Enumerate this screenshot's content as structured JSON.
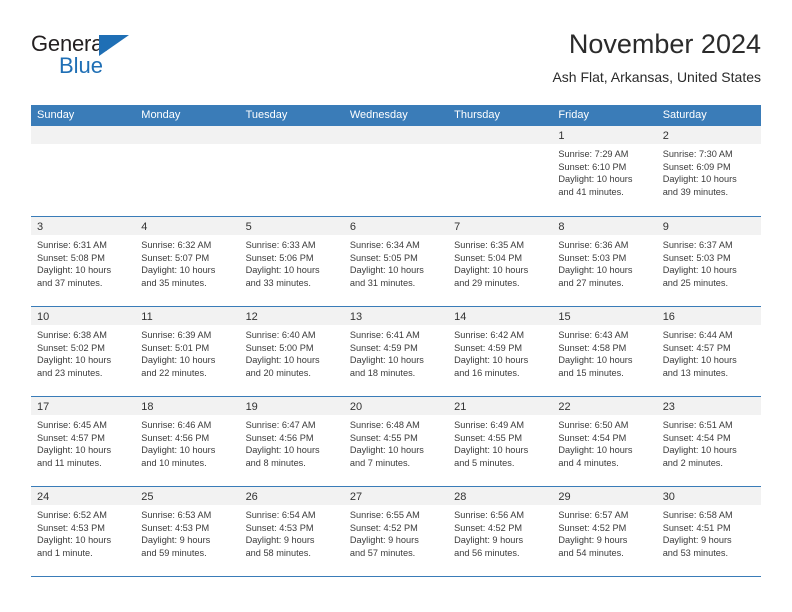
{
  "brand": {
    "name_top": "General",
    "name_bottom": "Blue",
    "triangle_color": "#1f6fb5"
  },
  "header": {
    "title": "November 2024",
    "subtitle": "Ash Flat, Arkansas, United States"
  },
  "theme": {
    "header_blue": "#3a7cb8",
    "daynum_band": "#f2f2f2",
    "text": "#3b3b3b"
  },
  "weekdays": [
    "Sunday",
    "Monday",
    "Tuesday",
    "Wednesday",
    "Thursday",
    "Friday",
    "Saturday"
  ],
  "weeks": [
    [
      {
        "empty": true
      },
      {
        "empty": true
      },
      {
        "empty": true
      },
      {
        "empty": true
      },
      {
        "empty": true
      },
      {
        "day": "1",
        "sunrise": "Sunrise: 7:29 AM",
        "sunset": "Sunset: 6:10 PM",
        "daylight_line1": "Daylight: 10 hours",
        "daylight_line2": "and 41 minutes."
      },
      {
        "day": "2",
        "sunrise": "Sunrise: 7:30 AM",
        "sunset": "Sunset: 6:09 PM",
        "daylight_line1": "Daylight: 10 hours",
        "daylight_line2": "and 39 minutes."
      }
    ],
    [
      {
        "day": "3",
        "sunrise": "Sunrise: 6:31 AM",
        "sunset": "Sunset: 5:08 PM",
        "daylight_line1": "Daylight: 10 hours",
        "daylight_line2": "and 37 minutes."
      },
      {
        "day": "4",
        "sunrise": "Sunrise: 6:32 AM",
        "sunset": "Sunset: 5:07 PM",
        "daylight_line1": "Daylight: 10 hours",
        "daylight_line2": "and 35 minutes."
      },
      {
        "day": "5",
        "sunrise": "Sunrise: 6:33 AM",
        "sunset": "Sunset: 5:06 PM",
        "daylight_line1": "Daylight: 10 hours",
        "daylight_line2": "and 33 minutes."
      },
      {
        "day": "6",
        "sunrise": "Sunrise: 6:34 AM",
        "sunset": "Sunset: 5:05 PM",
        "daylight_line1": "Daylight: 10 hours",
        "daylight_line2": "and 31 minutes."
      },
      {
        "day": "7",
        "sunrise": "Sunrise: 6:35 AM",
        "sunset": "Sunset: 5:04 PM",
        "daylight_line1": "Daylight: 10 hours",
        "daylight_line2": "and 29 minutes."
      },
      {
        "day": "8",
        "sunrise": "Sunrise: 6:36 AM",
        "sunset": "Sunset: 5:03 PM",
        "daylight_line1": "Daylight: 10 hours",
        "daylight_line2": "and 27 minutes."
      },
      {
        "day": "9",
        "sunrise": "Sunrise: 6:37 AM",
        "sunset": "Sunset: 5:03 PM",
        "daylight_line1": "Daylight: 10 hours",
        "daylight_line2": "and 25 minutes."
      }
    ],
    [
      {
        "day": "10",
        "sunrise": "Sunrise: 6:38 AM",
        "sunset": "Sunset: 5:02 PM",
        "daylight_line1": "Daylight: 10 hours",
        "daylight_line2": "and 23 minutes."
      },
      {
        "day": "11",
        "sunrise": "Sunrise: 6:39 AM",
        "sunset": "Sunset: 5:01 PM",
        "daylight_line1": "Daylight: 10 hours",
        "daylight_line2": "and 22 minutes."
      },
      {
        "day": "12",
        "sunrise": "Sunrise: 6:40 AM",
        "sunset": "Sunset: 5:00 PM",
        "daylight_line1": "Daylight: 10 hours",
        "daylight_line2": "and 20 minutes."
      },
      {
        "day": "13",
        "sunrise": "Sunrise: 6:41 AM",
        "sunset": "Sunset: 4:59 PM",
        "daylight_line1": "Daylight: 10 hours",
        "daylight_line2": "and 18 minutes."
      },
      {
        "day": "14",
        "sunrise": "Sunrise: 6:42 AM",
        "sunset": "Sunset: 4:59 PM",
        "daylight_line1": "Daylight: 10 hours",
        "daylight_line2": "and 16 minutes."
      },
      {
        "day": "15",
        "sunrise": "Sunrise: 6:43 AM",
        "sunset": "Sunset: 4:58 PM",
        "daylight_line1": "Daylight: 10 hours",
        "daylight_line2": "and 15 minutes."
      },
      {
        "day": "16",
        "sunrise": "Sunrise: 6:44 AM",
        "sunset": "Sunset: 4:57 PM",
        "daylight_line1": "Daylight: 10 hours",
        "daylight_line2": "and 13 minutes."
      }
    ],
    [
      {
        "day": "17",
        "sunrise": "Sunrise: 6:45 AM",
        "sunset": "Sunset: 4:57 PM",
        "daylight_line1": "Daylight: 10 hours",
        "daylight_line2": "and 11 minutes."
      },
      {
        "day": "18",
        "sunrise": "Sunrise: 6:46 AM",
        "sunset": "Sunset: 4:56 PM",
        "daylight_line1": "Daylight: 10 hours",
        "daylight_line2": "and 10 minutes."
      },
      {
        "day": "19",
        "sunrise": "Sunrise: 6:47 AM",
        "sunset": "Sunset: 4:56 PM",
        "daylight_line1": "Daylight: 10 hours",
        "daylight_line2": "and 8 minutes."
      },
      {
        "day": "20",
        "sunrise": "Sunrise: 6:48 AM",
        "sunset": "Sunset: 4:55 PM",
        "daylight_line1": "Daylight: 10 hours",
        "daylight_line2": "and 7 minutes."
      },
      {
        "day": "21",
        "sunrise": "Sunrise: 6:49 AM",
        "sunset": "Sunset: 4:55 PM",
        "daylight_line1": "Daylight: 10 hours",
        "daylight_line2": "and 5 minutes."
      },
      {
        "day": "22",
        "sunrise": "Sunrise: 6:50 AM",
        "sunset": "Sunset: 4:54 PM",
        "daylight_line1": "Daylight: 10 hours",
        "daylight_line2": "and 4 minutes."
      },
      {
        "day": "23",
        "sunrise": "Sunrise: 6:51 AM",
        "sunset": "Sunset: 4:54 PM",
        "daylight_line1": "Daylight: 10 hours",
        "daylight_line2": "and 2 minutes."
      }
    ],
    [
      {
        "day": "24",
        "sunrise": "Sunrise: 6:52 AM",
        "sunset": "Sunset: 4:53 PM",
        "daylight_line1": "Daylight: 10 hours",
        "daylight_line2": "and 1 minute."
      },
      {
        "day": "25",
        "sunrise": "Sunrise: 6:53 AM",
        "sunset": "Sunset: 4:53 PM",
        "daylight_line1": "Daylight: 9 hours",
        "daylight_line2": "and 59 minutes."
      },
      {
        "day": "26",
        "sunrise": "Sunrise: 6:54 AM",
        "sunset": "Sunset: 4:53 PM",
        "daylight_line1": "Daylight: 9 hours",
        "daylight_line2": "and 58 minutes."
      },
      {
        "day": "27",
        "sunrise": "Sunrise: 6:55 AM",
        "sunset": "Sunset: 4:52 PM",
        "daylight_line1": "Daylight: 9 hours",
        "daylight_line2": "and 57 minutes."
      },
      {
        "day": "28",
        "sunrise": "Sunrise: 6:56 AM",
        "sunset": "Sunset: 4:52 PM",
        "daylight_line1": "Daylight: 9 hours",
        "daylight_line2": "and 56 minutes."
      },
      {
        "day": "29",
        "sunrise": "Sunrise: 6:57 AM",
        "sunset": "Sunset: 4:52 PM",
        "daylight_line1": "Daylight: 9 hours",
        "daylight_line2": "and 54 minutes."
      },
      {
        "day": "30",
        "sunrise": "Sunrise: 6:58 AM",
        "sunset": "Sunset: 4:51 PM",
        "daylight_line1": "Daylight: 9 hours",
        "daylight_line2": "and 53 minutes."
      }
    ]
  ]
}
